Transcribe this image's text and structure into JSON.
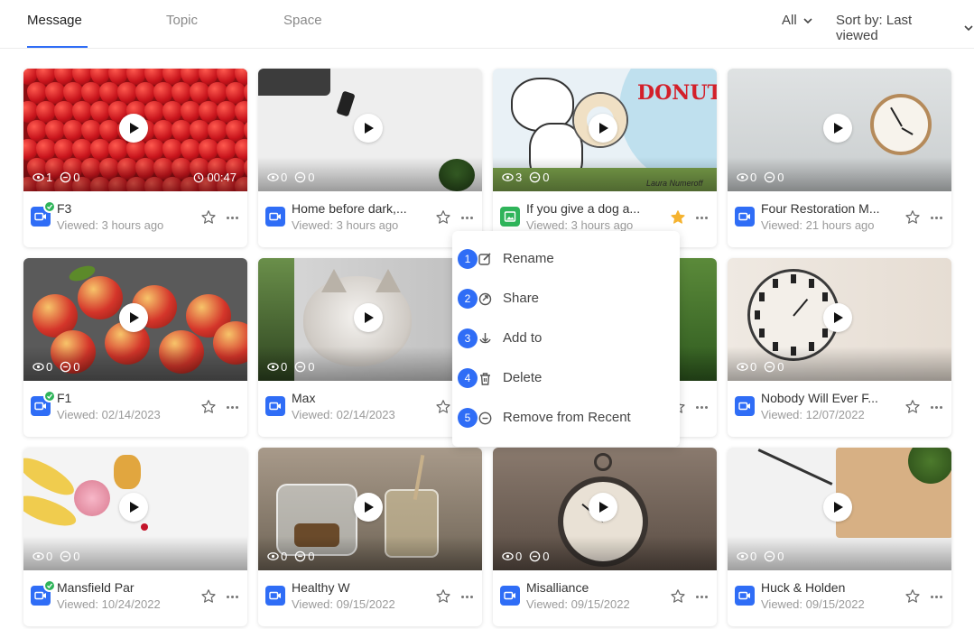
{
  "tabs": [
    {
      "label": "Message",
      "active": true
    },
    {
      "label": "Topic",
      "active": false
    },
    {
      "label": "Space",
      "active": false
    }
  ],
  "filters": {
    "all_label": "All",
    "sort_label": "Sort by: Last viewed"
  },
  "cards": [
    {
      "title": "F3",
      "viewed": "Viewed: 3 hours ago",
      "views": "1",
      "comments": "0",
      "duration": "00:47",
      "type": "video",
      "badge": true,
      "starred": false,
      "thumb": "strawberries"
    },
    {
      "title": "Home before dark,...",
      "viewed": "Viewed: 3 hours ago",
      "views": "0",
      "comments": "0",
      "type": "video",
      "badge": false,
      "starred": false,
      "thumb": "desk"
    },
    {
      "title": "If you give a dog a...",
      "viewed": "Viewed: 3 hours ago",
      "views": "3",
      "comments": "0",
      "type": "image",
      "badge": false,
      "starred": true,
      "thumb": "dogdonut",
      "thumb_text": "DONUT",
      "thumb_caption": "Laura Numeroff"
    },
    {
      "title": "Four Restoration M...",
      "viewed": "Viewed: 21 hours ago",
      "views": "0",
      "comments": "0",
      "type": "video",
      "badge": false,
      "starred": false,
      "thumb": "clockwall"
    },
    {
      "title": "F1",
      "viewed": "Viewed: 02/14/2023",
      "views": "0",
      "comments": "0",
      "type": "video",
      "badge": true,
      "starred": false,
      "thumb": "apples"
    },
    {
      "title": "Max",
      "viewed": "Viewed: 02/14/2023",
      "views": "0",
      "comments": "0",
      "type": "video",
      "badge": false,
      "starred": false,
      "thumb": "cat"
    },
    {
      "title": "",
      "viewed": "",
      "views": "",
      "comments": "",
      "type": "video",
      "badge": false,
      "starred": false,
      "thumb": "garden"
    },
    {
      "title": "Nobody Will Ever F...",
      "viewed": "Viewed: 12/07/2022",
      "views": "0",
      "comments": "0",
      "type": "video",
      "badge": false,
      "starred": false,
      "thumb": "bigclock"
    },
    {
      "title": "Mansfield Par",
      "viewed": "Viewed: 10/24/2022",
      "views": "0",
      "comments": "0",
      "type": "video",
      "badge": true,
      "starred": false,
      "thumb": "fruit"
    },
    {
      "title": "Healthy W",
      "viewed": "Viewed: 09/15/2022",
      "views": "0",
      "comments": "0",
      "type": "video",
      "badge": false,
      "starred": false,
      "thumb": "jars"
    },
    {
      "title": "Misalliance",
      "viewed": "Viewed: 09/15/2022",
      "views": "0",
      "comments": "0",
      "type": "video",
      "badge": false,
      "starred": false,
      "thumb": "alarm"
    },
    {
      "title": "Huck & Holden",
      "viewed": "Viewed: 09/15/2022",
      "views": "0",
      "comments": "0",
      "type": "video",
      "badge": false,
      "starred": false,
      "thumb": "notebook"
    }
  ],
  "context_menu": {
    "items": [
      {
        "num": "1",
        "label": "Rename",
        "icon": "edit-icon"
      },
      {
        "num": "2",
        "label": "Share",
        "icon": "share-icon"
      },
      {
        "num": "3",
        "label": "Add to",
        "icon": "download-icon"
      },
      {
        "num": "4",
        "label": "Delete",
        "icon": "trash-icon"
      },
      {
        "num": "5",
        "label": "Remove from Recent",
        "icon": "remove-circle-icon"
      }
    ]
  },
  "colors": {
    "accent": "#2f6df6",
    "green": "#2fb45a",
    "star": "#f5b330"
  }
}
